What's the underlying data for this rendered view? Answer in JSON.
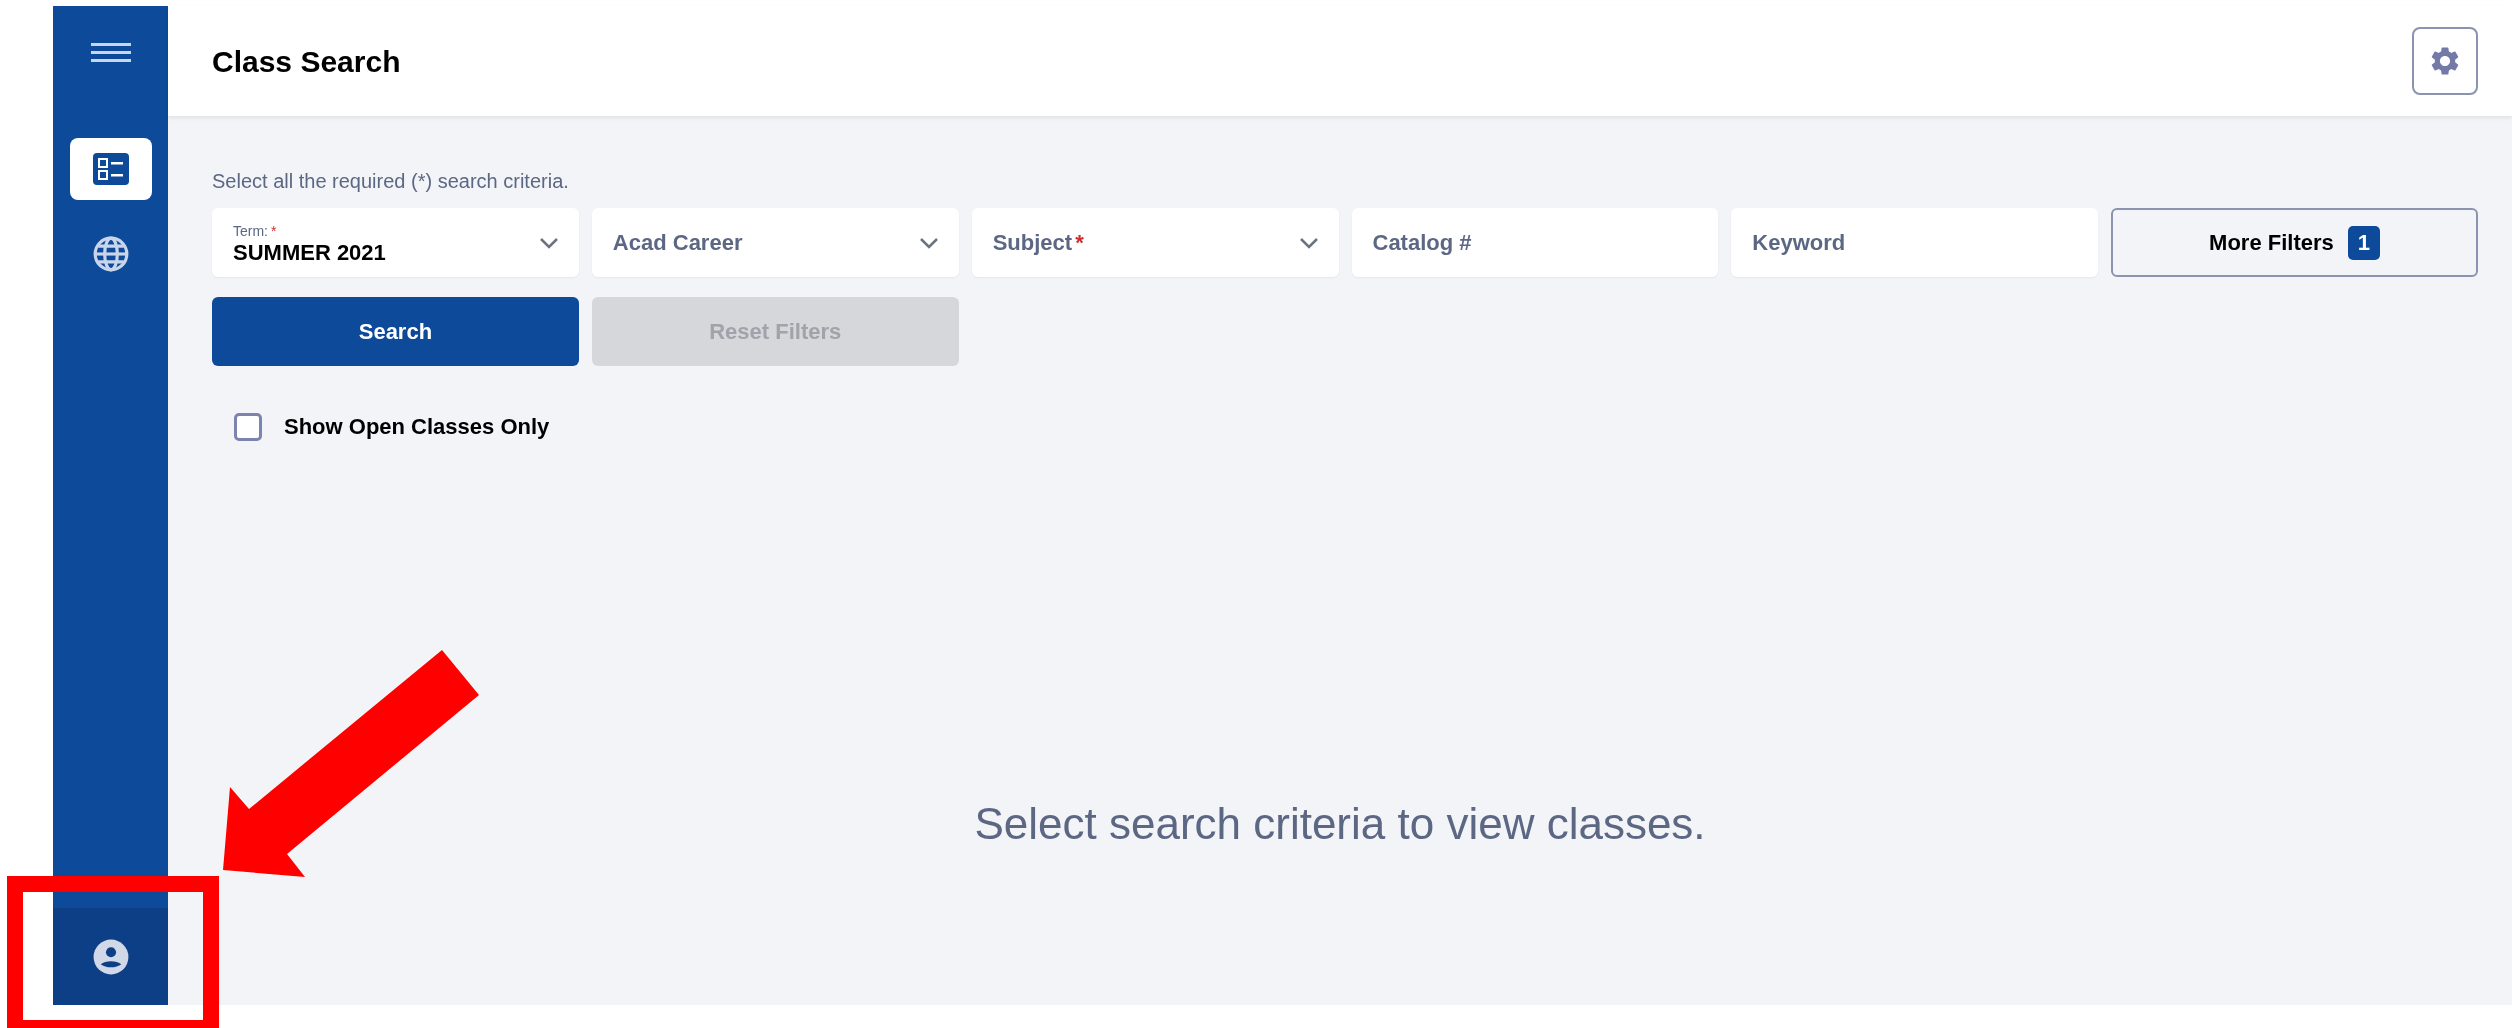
{
  "sidebar": {
    "items": [
      {
        "kind": "menu",
        "selected": false
      },
      {
        "kind": "list",
        "selected": true
      },
      {
        "kind": "globe",
        "selected": false
      }
    ],
    "footer": {
      "kind": "user",
      "selected": false
    }
  },
  "header": {
    "title": "Class Search"
  },
  "intro": "Select all the required (*) search criteria.",
  "filters": [
    {
      "kind": "select",
      "label": "Term:",
      "marker": "*",
      "value": "SUMMER 2021"
    },
    {
      "kind": "select",
      "placeholder": "Acad Career"
    },
    {
      "kind": "select",
      "placeholder": "Subject",
      "marker": "*"
    },
    {
      "kind": "text",
      "placeholder": "Catalog #"
    },
    {
      "kind": "text",
      "placeholder": "Keyword"
    }
  ],
  "more_filters": {
    "label": "More Filters",
    "count": "1"
  },
  "buttons": [
    {
      "label": "Search",
      "disabled": false
    },
    {
      "label": "Reset Filters",
      "disabled": true
    }
  ],
  "open_only": {
    "label": "Show Open Classes Only",
    "checked": false
  },
  "empty_message": "Select search criteria to view classes."
}
